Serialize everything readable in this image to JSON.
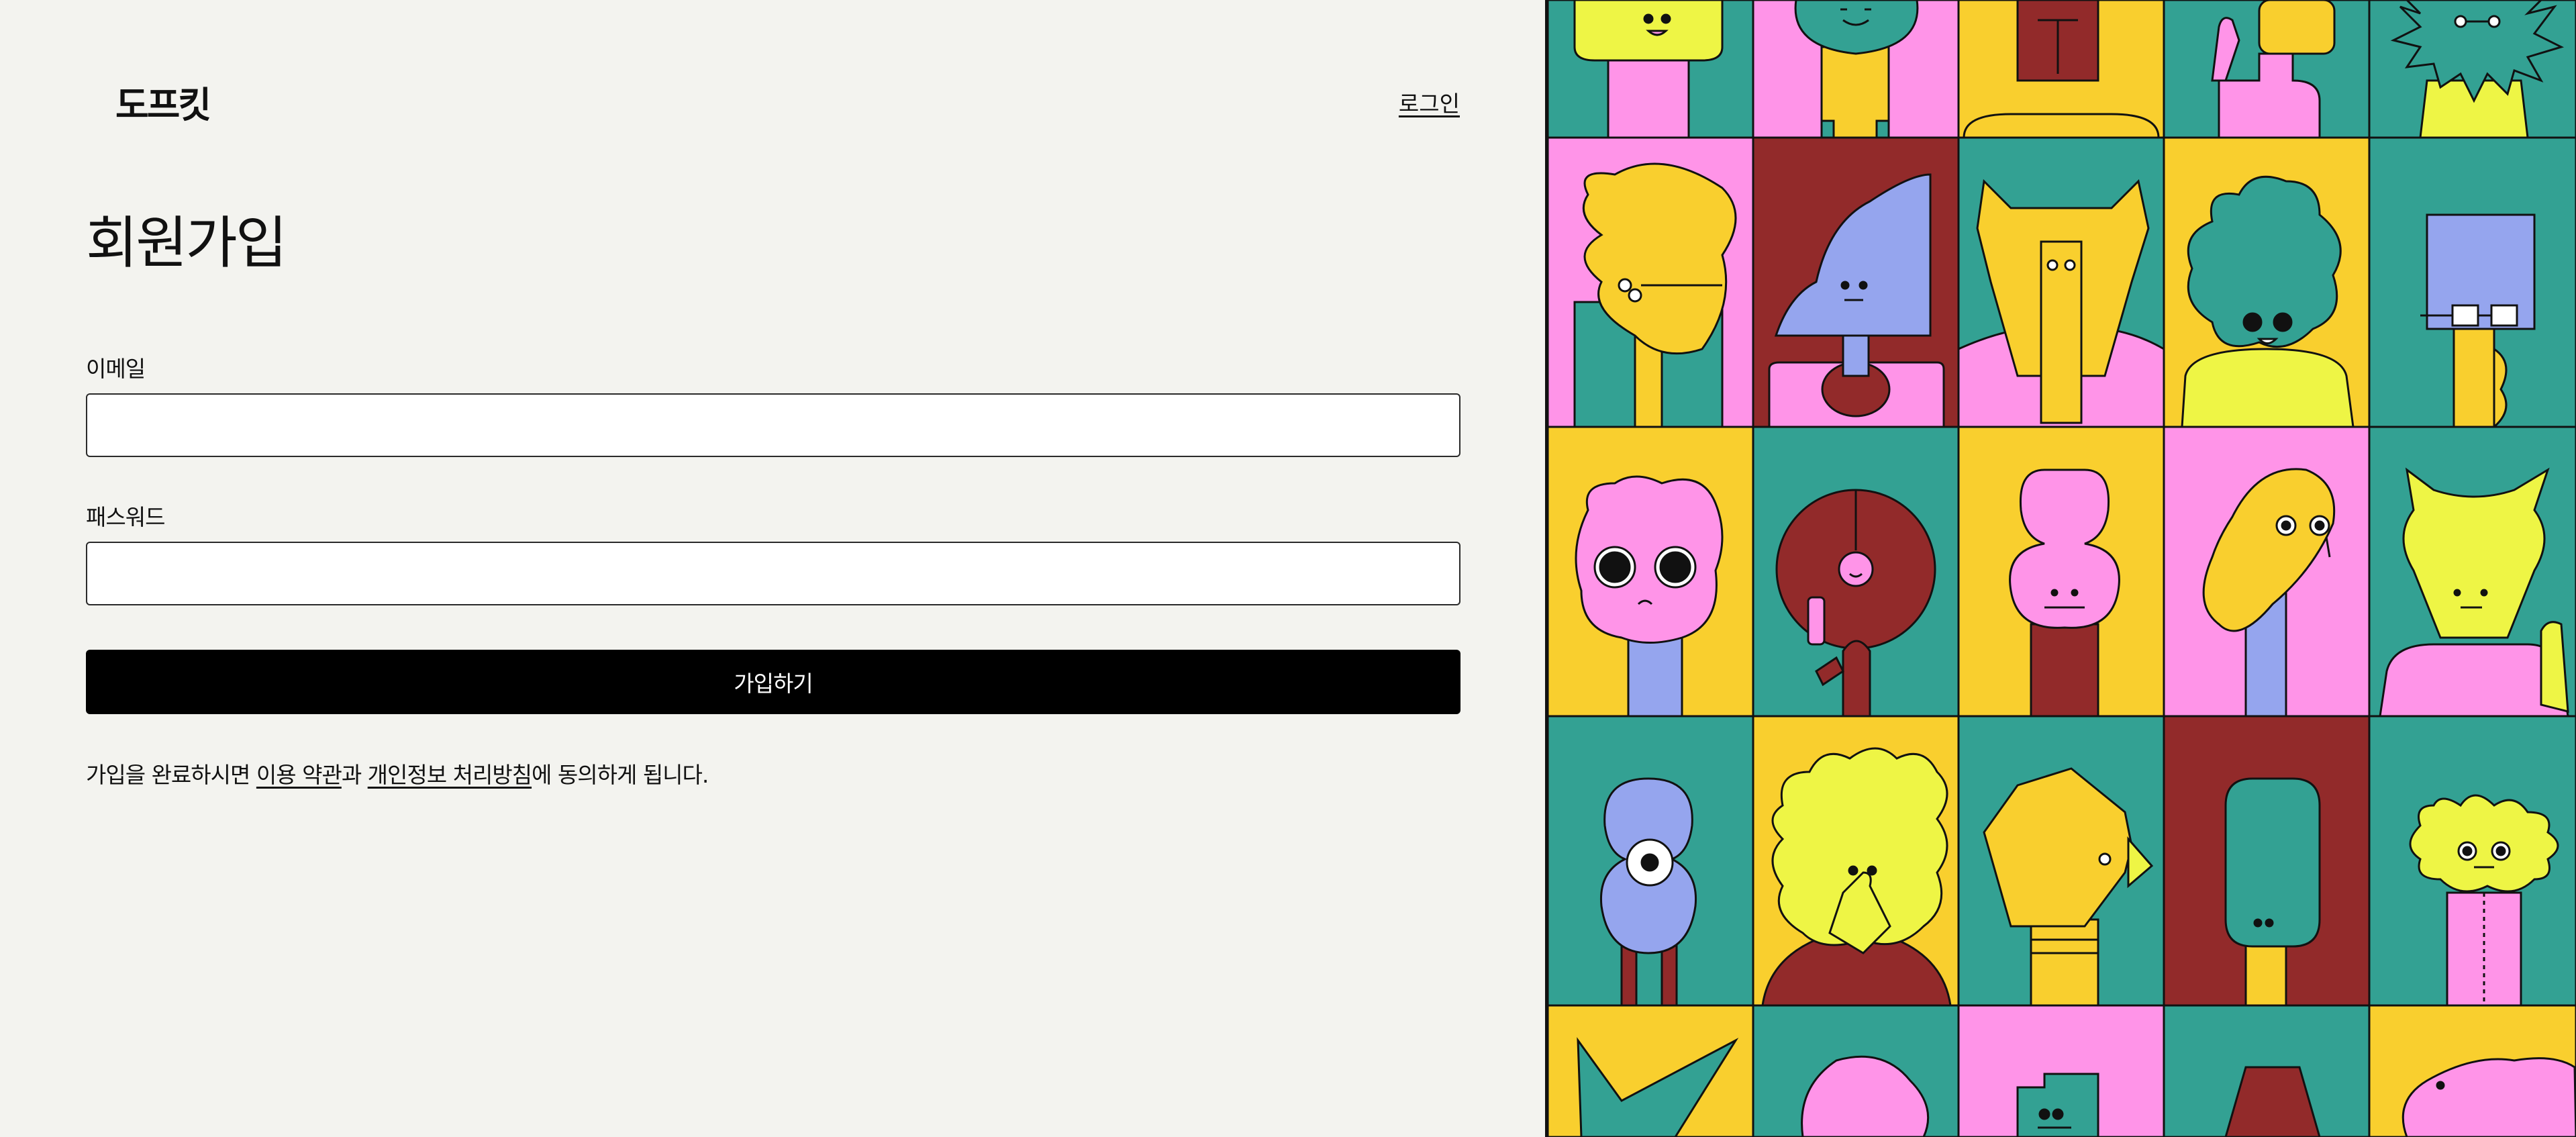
{
  "header": {
    "logo_text": "도프킷",
    "login_label": "로그인"
  },
  "form": {
    "title": "회원가입",
    "email_label": "이메일",
    "email_value": "",
    "email_placeholder": "",
    "password_label": "패스워드",
    "password_value": "",
    "password_placeholder": "",
    "submit_label": "가입하기"
  },
  "terms": {
    "prefix": "가입을 완료하시면 ",
    "terms_link": "이용 약관",
    "middle": "과 ",
    "privacy_link": "개인정보 처리방침",
    "suffix": "에 동의하게 됩니다."
  },
  "colors": {
    "background": "#f3f3ef",
    "button": "#000000",
    "pink": "#ff94e8",
    "teal": "#33a193",
    "yellow": "#f9cf2e",
    "lime": "#eef545",
    "maroon": "#922a2a",
    "periwinkle": "#95a5ee"
  },
  "illustration": {
    "description_name": "character-grid",
    "tile_colors": [
      [
        "teal",
        "pink",
        "yellow",
        "teal",
        "teal"
      ],
      [
        "pink",
        "maroon",
        "teal",
        "yellow",
        "teal"
      ],
      [
        "yellow",
        "teal",
        "yellow",
        "pink",
        "teal"
      ],
      [
        "teal",
        "yellow",
        "teal",
        "maroon",
        "teal"
      ],
      [
        "yellow",
        "teal",
        "pink",
        "teal",
        "yellow"
      ]
    ]
  }
}
